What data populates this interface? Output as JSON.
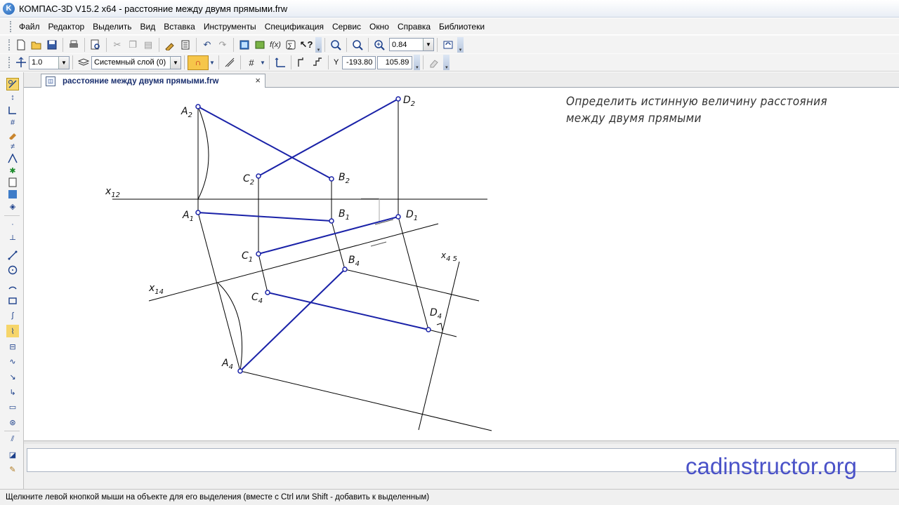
{
  "window": {
    "title": "КОМПАС-3D V15.2  x64 - расстояние между двумя прямыми.frw",
    "app_icon_letter": "K"
  },
  "menu": [
    "Файл",
    "Редактор",
    "Выделить",
    "Вид",
    "Вставка",
    "Инструменты",
    "Спецификация",
    "Сервис",
    "Окно",
    "Справка",
    "Библиотеки"
  ],
  "toolbar": {
    "zoom_value": "0.84",
    "line_scale": "1.0",
    "layer": "Системный слой (0)",
    "coord_label": "Y",
    "coord_x": "-193.80",
    "coord_y": "105.89"
  },
  "document_tab": {
    "label": "расстояние между двумя прямыми.frw"
  },
  "drawing": {
    "note_line1": "Определить истинную величину расстояния",
    "note_line2": "между двумя прямыми",
    "labels": {
      "A2": "A2",
      "B2": "B2",
      "C2": "C2",
      "D2": "D2",
      "A1": "A1",
      "B1": "B1",
      "C1": "C1",
      "D1": "D1",
      "A4": "A4",
      "B4": "B4",
      "C4": "C4",
      "D4": "D4",
      "x12": "x12",
      "x14": "x14",
      "x45": "x4 5"
    },
    "line_color": "#1a22a8",
    "construction_color": "#000000"
  },
  "watermark": "cadinstructor.org",
  "status": "Щелкните левой кнопкой мыши на объекте для его выделения (вместе с Ctrl или Shift - добавить к выделенным)"
}
